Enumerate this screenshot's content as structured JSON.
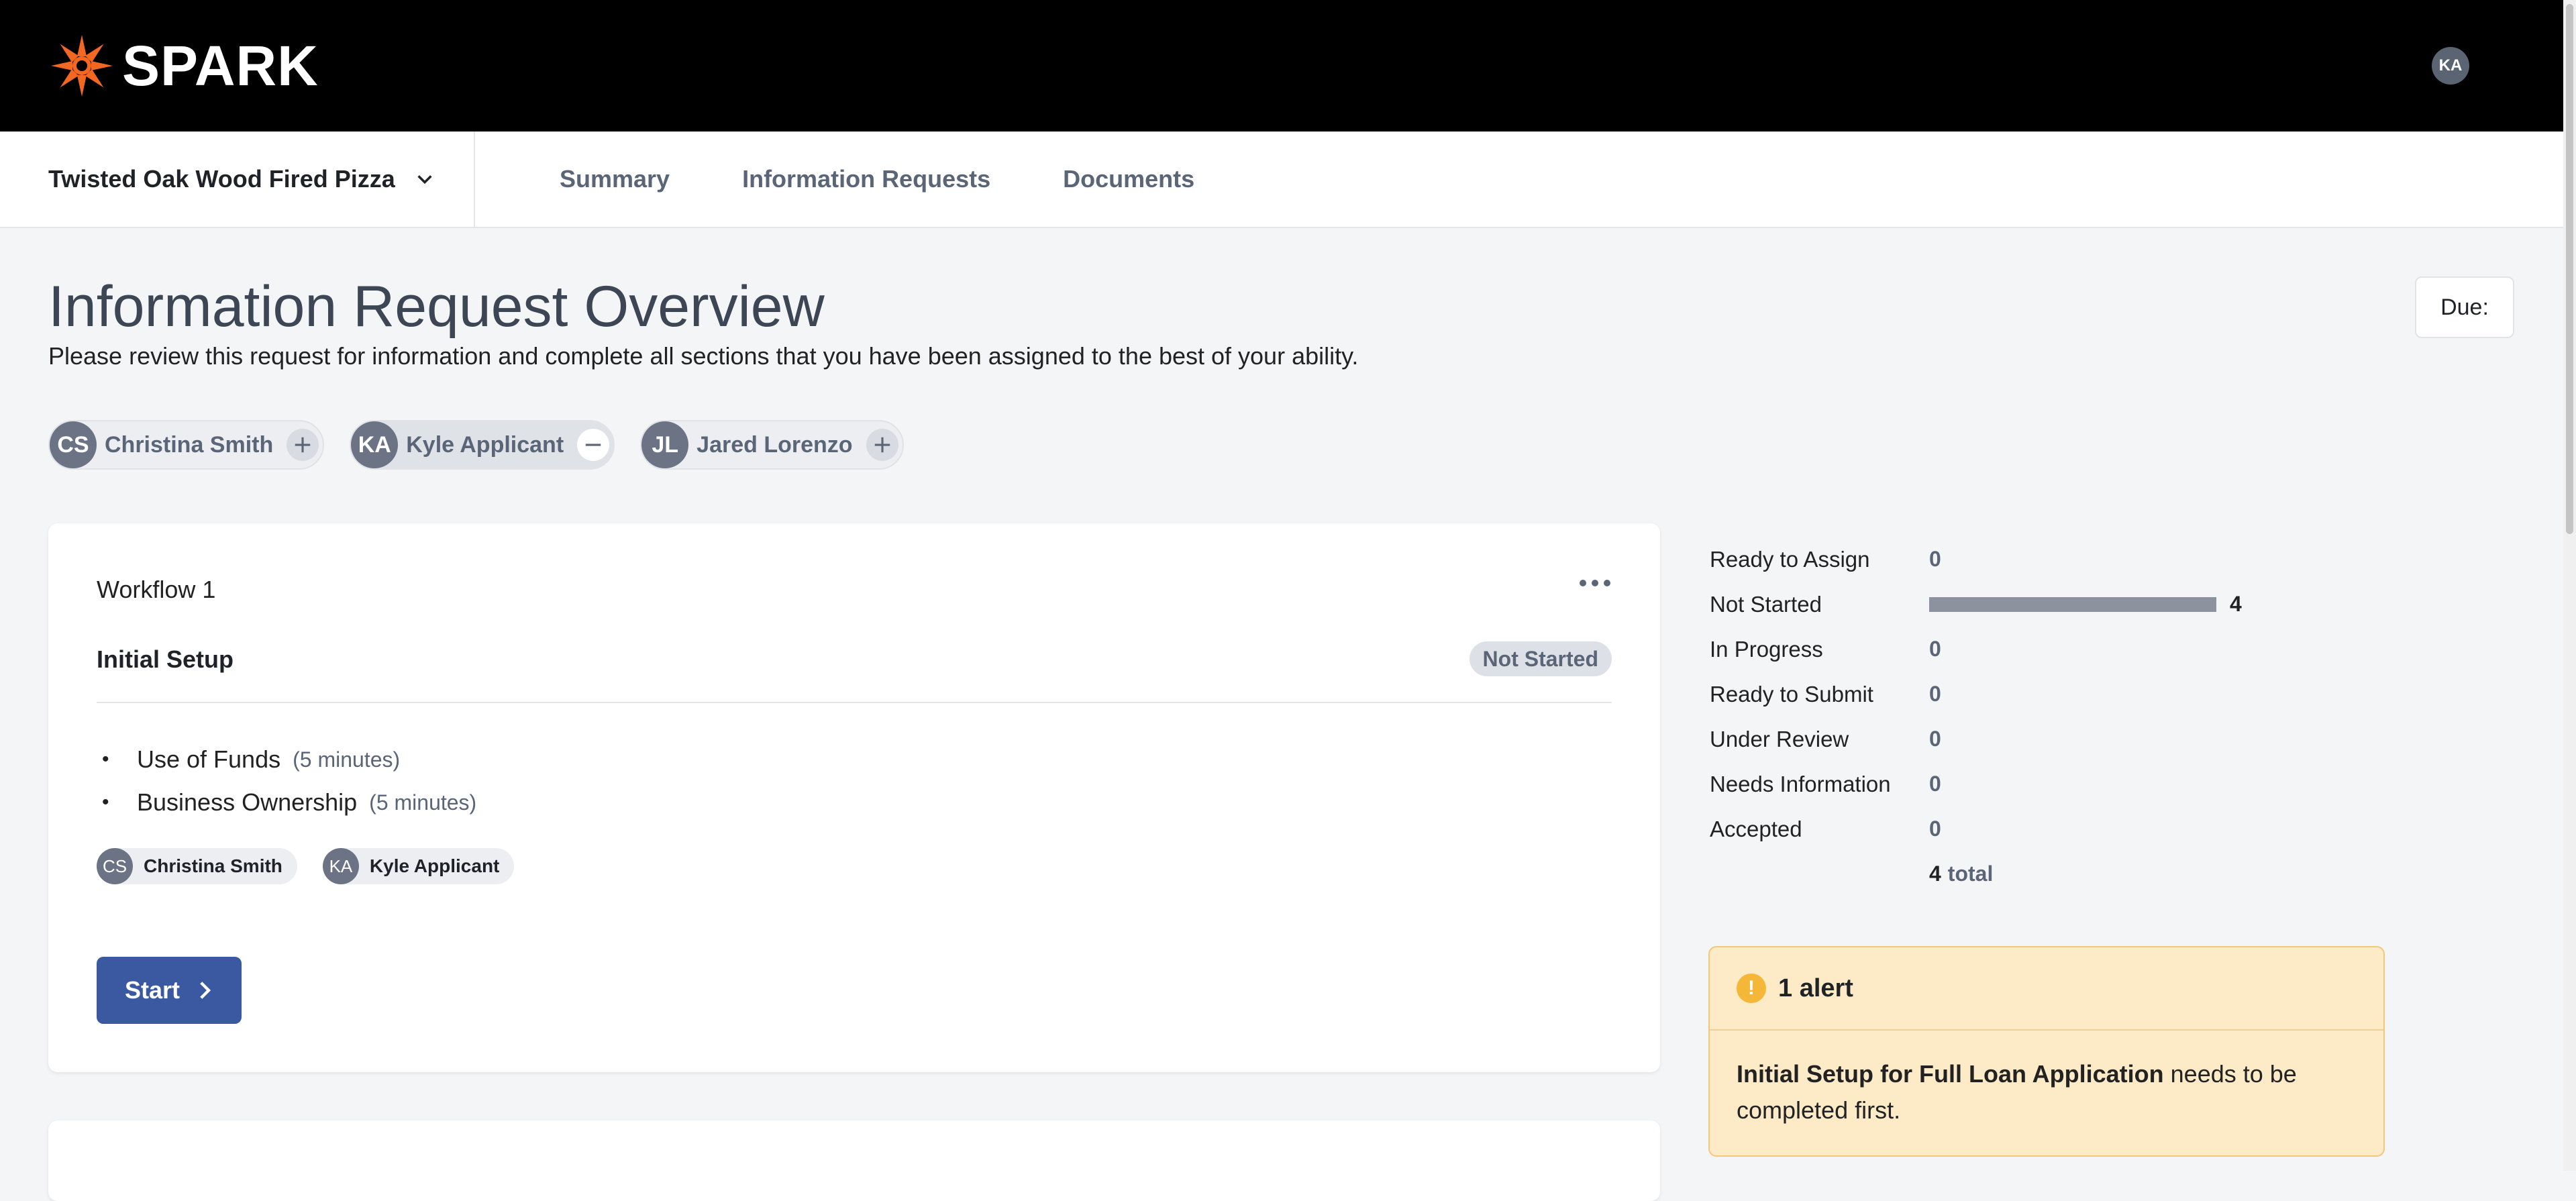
{
  "brand": {
    "name": "SPARK",
    "accent": "#f26722"
  },
  "user": {
    "initials": "KA"
  },
  "business": {
    "name": "Twisted Oak Wood Fired Pizza"
  },
  "nav": {
    "tabs": [
      "Summary",
      "Information Requests",
      "Documents"
    ]
  },
  "page": {
    "title": "Information Request Overview",
    "description": "Please review this request for information and complete all sections that you have been assigned to the best of your ability.",
    "due_label": "Due:"
  },
  "participants": [
    {
      "initials": "CS",
      "name": "Christina Smith",
      "action": "plus"
    },
    {
      "initials": "KA",
      "name": "Kyle Applicant",
      "action": "minus"
    },
    {
      "initials": "JL",
      "name": "Jared Lorenzo",
      "action": "plus"
    }
  ],
  "workflow": {
    "title": "Workflow 1",
    "section_title": "Initial Setup",
    "status": "Not Started",
    "tasks": [
      {
        "name": "Use of Funds",
        "duration": "(5 minutes)"
      },
      {
        "name": "Business Ownership",
        "duration": "(5 minutes)"
      }
    ],
    "assignees": [
      {
        "initials": "CS",
        "name": "Christina Smith"
      },
      {
        "initials": "KA",
        "name": "Kyle Applicant"
      }
    ],
    "start_label": "Start"
  },
  "stats": {
    "rows": [
      {
        "label": "Ready to Assign",
        "value": "0"
      },
      {
        "label": "Not Started",
        "value": "4"
      },
      {
        "label": "In Progress",
        "value": "0"
      },
      {
        "label": "Ready to Submit",
        "value": "0"
      },
      {
        "label": "Under Review",
        "value": "0"
      },
      {
        "label": "Needs Information",
        "value": "0"
      },
      {
        "label": "Accepted",
        "value": "0"
      }
    ],
    "total_value": "4",
    "total_word": "total"
  },
  "alert": {
    "icon": "!",
    "title": "1 alert",
    "body_bold": "Initial Setup for Full Loan Application",
    "body_rest": " needs to be completed first."
  }
}
